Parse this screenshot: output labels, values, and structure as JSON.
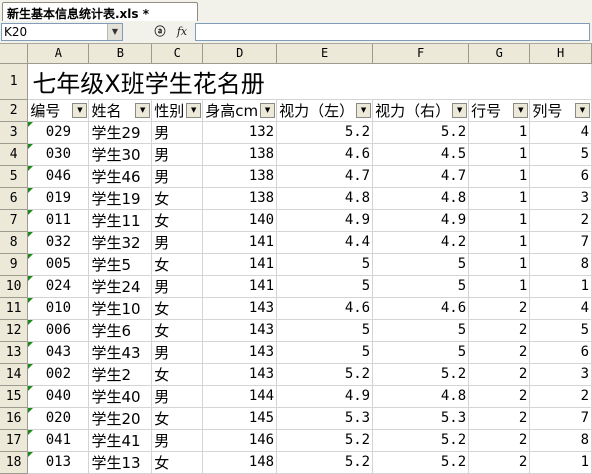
{
  "workbook": {
    "tab_label": "新生基本信息统计表.xls *"
  },
  "formula_bar": {
    "name_box": "K20",
    "fx_label": "fx"
  },
  "sheet": {
    "columns": [
      "A",
      "B",
      "C",
      "D",
      "E",
      "F",
      "G",
      "H"
    ],
    "title": "七年级X班学生花名册",
    "headers": [
      "编号",
      "姓名",
      "性别",
      "身高cm",
      "视力（左）",
      "视力（右）",
      "行号",
      "列号"
    ],
    "rows": [
      {
        "n": "3",
        "id": "029",
        "name": "学生29",
        "sex": "男",
        "height": "132",
        "left": "5.2",
        "right": "5.2",
        "row": "1",
        "col": "4"
      },
      {
        "n": "4",
        "id": "030",
        "name": "学生30",
        "sex": "男",
        "height": "138",
        "left": "4.6",
        "right": "4.5",
        "row": "1",
        "col": "5"
      },
      {
        "n": "5",
        "id": "046",
        "name": "学生46",
        "sex": "男",
        "height": "138",
        "left": "4.7",
        "right": "4.7",
        "row": "1",
        "col": "6"
      },
      {
        "n": "6",
        "id": "019",
        "name": "学生19",
        "sex": "女",
        "height": "138",
        "left": "4.8",
        "right": "4.8",
        "row": "1",
        "col": "3"
      },
      {
        "n": "7",
        "id": "011",
        "name": "学生11",
        "sex": "女",
        "height": "140",
        "left": "4.9",
        "right": "4.9",
        "row": "1",
        "col": "2"
      },
      {
        "n": "8",
        "id": "032",
        "name": "学生32",
        "sex": "男",
        "height": "141",
        "left": "4.4",
        "right": "4.2",
        "row": "1",
        "col": "7"
      },
      {
        "n": "9",
        "id": "005",
        "name": "学生5",
        "sex": "女",
        "height": "141",
        "left": "5",
        "right": "5",
        "row": "1",
        "col": "8"
      },
      {
        "n": "10",
        "id": "024",
        "name": "学生24",
        "sex": "男",
        "height": "141",
        "left": "5",
        "right": "5",
        "row": "1",
        "col": "1"
      },
      {
        "n": "11",
        "id": "010",
        "name": "学生10",
        "sex": "女",
        "height": "143",
        "left": "4.6",
        "right": "4.6",
        "row": "2",
        "col": "4"
      },
      {
        "n": "12",
        "id": "006",
        "name": "学生6",
        "sex": "女",
        "height": "143",
        "left": "5",
        "right": "5",
        "row": "2",
        "col": "5"
      },
      {
        "n": "13",
        "id": "043",
        "name": "学生43",
        "sex": "男",
        "height": "143",
        "left": "5",
        "right": "5",
        "row": "2",
        "col": "6"
      },
      {
        "n": "14",
        "id": "002",
        "name": "学生2",
        "sex": "女",
        "height": "143",
        "left": "5.2",
        "right": "5.2",
        "row": "2",
        "col": "3"
      },
      {
        "n": "15",
        "id": "040",
        "name": "学生40",
        "sex": "男",
        "height": "144",
        "left": "4.9",
        "right": "4.8",
        "row": "2",
        "col": "2"
      },
      {
        "n": "16",
        "id": "020",
        "name": "学生20",
        "sex": "女",
        "height": "145",
        "left": "5.3",
        "right": "5.3",
        "row": "2",
        "col": "7"
      },
      {
        "n": "17",
        "id": "041",
        "name": "学生41",
        "sex": "男",
        "height": "146",
        "left": "5.2",
        "right": "5.2",
        "row": "2",
        "col": "8"
      },
      {
        "n": "18",
        "id": "013",
        "name": "学生13",
        "sex": "女",
        "height": "148",
        "left": "5.2",
        "right": "5.2",
        "row": "2",
        "col": "1"
      }
    ]
  }
}
